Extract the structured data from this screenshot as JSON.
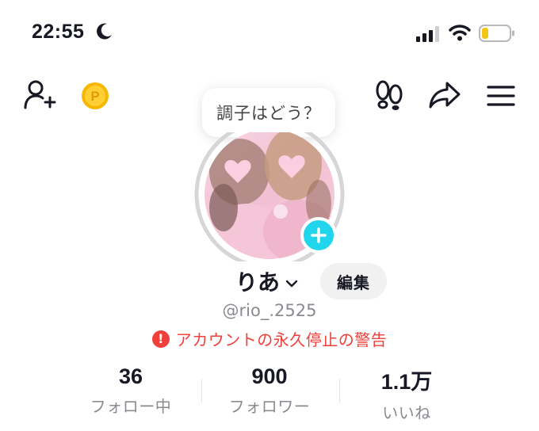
{
  "status_bar": {
    "time": "22:55"
  },
  "header": {
    "icons": [
      "add-friend-icon",
      "coin-icon",
      "footprints-icon",
      "share-icon",
      "menu-icon"
    ]
  },
  "mood_bubble": {
    "text": "調子はどう？"
  },
  "profile": {
    "display_name": "りあ",
    "edit_label": "編集",
    "username": "@rio_.2525",
    "warning_text": "アカウントの永久停止の警告",
    "warning_icon": "!"
  },
  "stats": [
    {
      "value": "36",
      "label": "フォロー中"
    },
    {
      "value": "900",
      "label": "フォロワー"
    },
    {
      "value": "1.1万",
      "label": "いいね"
    }
  ],
  "colors": {
    "accent_cyan": "#20d5ec",
    "warning_red": "#f0403b",
    "battery_low": "#f5c518"
  }
}
